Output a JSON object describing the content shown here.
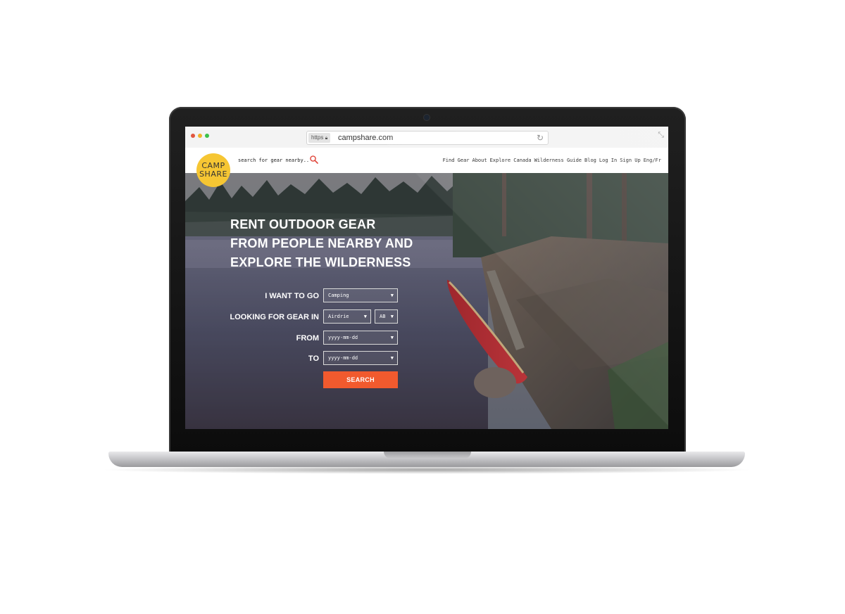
{
  "browser": {
    "url_protocol": "https",
    "url": "campshare.com",
    "traffic_light_colors": [
      "#e0563e",
      "#f0b429",
      "#3cc14a"
    ]
  },
  "site": {
    "logo": {
      "line1": "CAMP",
      "line2": "SHARE",
      "color": "#f6c633"
    },
    "search_placeholder": "search for gear nearby..",
    "nav": {
      "find_gear": "Find Gear",
      "about": "About",
      "explore_canada": "Explore Canada",
      "wilderness_guide": "Wilderness Guide",
      "blog": "Blog",
      "log_in": "Log In",
      "sign_up": "Sign Up",
      "language": "Eng/Fr"
    }
  },
  "hero": {
    "title_lines": [
      "RENT OUTDOOR GEAR",
      "FROM PEOPLE NEARBY AND",
      "EXPLORE THE WILDERNESS"
    ],
    "form": {
      "want_to_go_label": "I WANT TO GO",
      "want_to_go_value": "Camping",
      "gear_in_label": "LOOKING FOR GEAR IN",
      "city_value": "Airdrie",
      "province_value": "AB",
      "from_label": "FROM",
      "from_placeholder": "yyyy-mm-dd",
      "to_label": "TO",
      "to_placeholder": "yyyy-mm-dd",
      "search_button": "SEARCH",
      "accent_color": "#f15a2e"
    }
  }
}
